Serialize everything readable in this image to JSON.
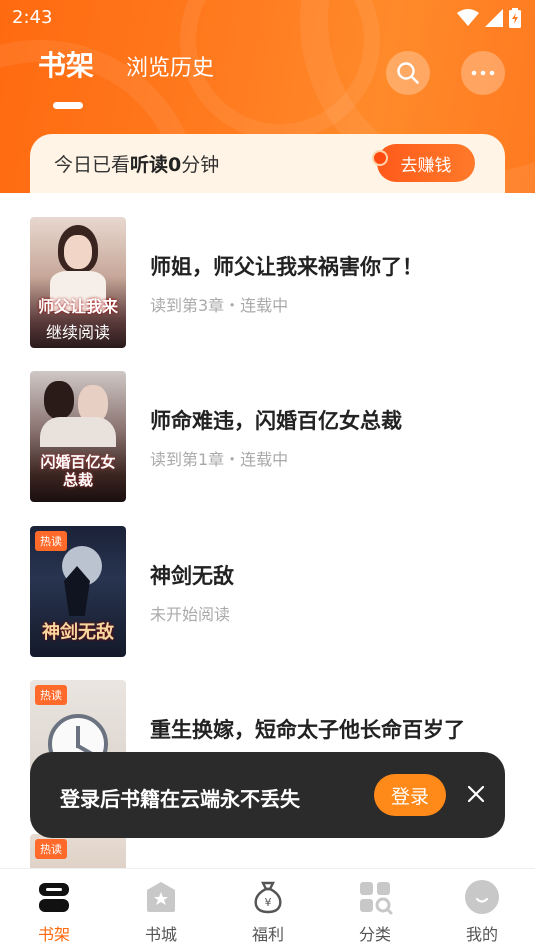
{
  "status_bar": {
    "time": "2:43"
  },
  "header": {
    "tabs": [
      {
        "label": "书架",
        "active": true
      },
      {
        "label": "浏览历史",
        "active": false
      }
    ],
    "accent_color": "#ff6a10"
  },
  "reading_banner": {
    "prefix": "今日已看",
    "bold_part": "听读0",
    "suffix": "分钟",
    "earn_button": "去赚钱"
  },
  "books": [
    {
      "title": "师姐，师父让我来祸害你了！",
      "progress": "读到第3章・连载中",
      "badge": "",
      "cover_text": "师父让我来",
      "cover_subtext": "继续阅读"
    },
    {
      "title": "师命难违，闪婚百亿女总裁",
      "progress": "读到第1章・连载中",
      "badge": "",
      "cover_text": "闪婚百亿女总裁",
      "cover_subtext": ""
    },
    {
      "title": "神剑无敌",
      "progress": "未开始阅读",
      "badge": "热读",
      "cover_text": "神剑无敌",
      "cover_subtext": ""
    },
    {
      "title": "重生换嫁，短命太子他长命百岁了",
      "progress": "",
      "badge": "热读",
      "cover_text": "",
      "cover_subtext": ""
    },
    {
      "title": "",
      "progress": "",
      "badge": "热读",
      "cover_text": "",
      "cover_subtext": ""
    }
  ],
  "toast": {
    "message": "登录后书籍在云端永不丢失",
    "login_button": "登录"
  },
  "bottom_nav": [
    {
      "label": "书架",
      "icon": "bookshelf-icon",
      "active": true
    },
    {
      "label": "书城",
      "icon": "bookstore-icon",
      "active": false
    },
    {
      "label": "福利",
      "icon": "money-bag-icon",
      "active": false
    },
    {
      "label": "分类",
      "icon": "category-grid-icon",
      "active": false
    },
    {
      "label": "我的",
      "icon": "avatar-icon",
      "active": false
    }
  ]
}
